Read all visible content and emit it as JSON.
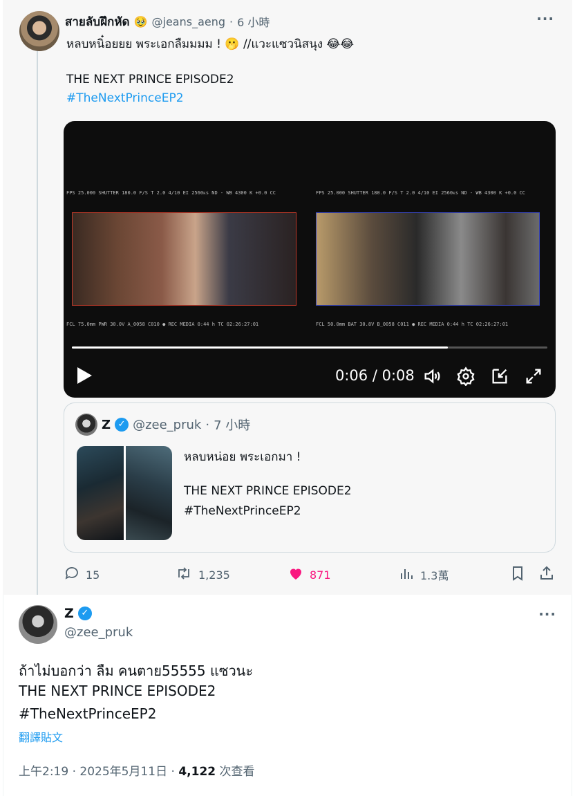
{
  "parent_tweet": {
    "display_name": "สายลับฝึกหัด",
    "name_emoji": "🥹",
    "handle": "@jeans_aeng",
    "time_sep": "·",
    "time": "6 小時",
    "more": "···",
    "text_line1": "หลบหนิ๋อยยย พระเอกลืมมมม ! 🫢 //แวะแซวนิสนุง 😂😂",
    "text_line2": "THE NEXT PRINCE EPISODE2",
    "hashtag": "#TheNextPrinceEP2",
    "video": {
      "current_time": "0:06",
      "duration": "0:08",
      "time_display": "0:06 / 0:08",
      "progress": 0.79,
      "cam_a_hud_top": "FPS 25.000  SHUTTER 180.0  F/S T 2.0  4/10  EI 2560ᴋs  ND -  WB 4300 K +0.0 CC",
      "cam_a_hud_bottom": "FCL 75.0mm  PWR 30.0V  A_0058  C010  ● REC  MEDIA 0:44 h  TC 02:26:27:01",
      "cam_b_hud_top": "FPS 25.000  SHUTTER 180.0  F/S T 2.0  4/10  EI 2560ᴋs  ND -  WB 4300 K +0.0 CC",
      "cam_b_hud_bottom": "FCL 50.0mm  BAT 30.8V  B_0058  C011  ● REC  MEDIA 0:44 h  TC 02:26:27:01"
    },
    "quote": {
      "name": "Z",
      "verified_mark": "✓",
      "handle": "@zee_pruk",
      "time_sep": "·",
      "time": "7 小時",
      "text_line1": "หลบหน่อย พระเอกมา !",
      "text_line2": "THE NEXT PRINCE EPISODE2",
      "hashtag": "#TheNextPrinceEP2"
    },
    "actions": {
      "replies": "15",
      "retweets": "1,235",
      "likes": "871",
      "views": "1.3萬"
    }
  },
  "main_tweet": {
    "display_name": "Z",
    "verified_mark": "✓",
    "handle": "@zee_pruk",
    "more": "···",
    "text_line1": "ถ้าไม่บอกว่า ลืม คนตาย55555 แซวนะ",
    "text_line2": "THE NEXT PRINCE EPISODE2",
    "hashtag": "#TheNextPrinceEP2",
    "translate": "翻譯貼文",
    "time": "上午2:19",
    "date": "2025年5月11日",
    "views_count": "4,122",
    "views_label": "次查看"
  },
  "colors": {
    "accent": "#1d9bf0",
    "like": "#f91880",
    "secondary_text": "#536471"
  }
}
